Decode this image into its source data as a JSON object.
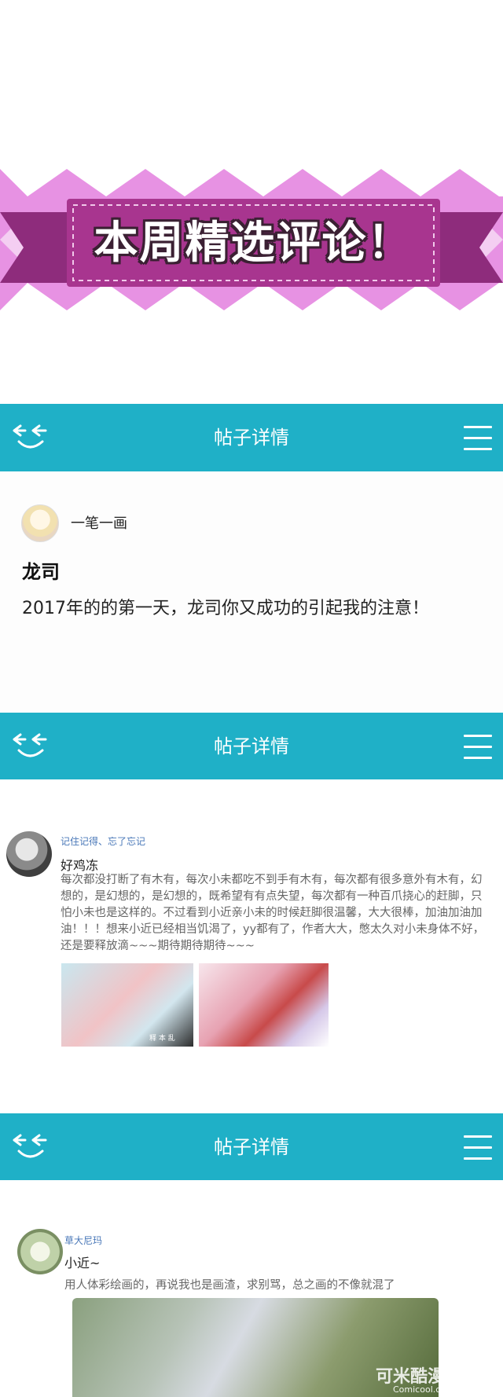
{
  "banner": {
    "title": "本周精选评论！"
  },
  "app_header": {
    "title": "帖子详情"
  },
  "post1": {
    "username": "一笔一画",
    "title": "龙司",
    "body": "2017年的的第一天，龙司你又成功的引起我的注意！"
  },
  "post2": {
    "tag": "记住记得、忘了忘记",
    "username": "好鸡冻",
    "body": "每次都没打断了有木有，每次小未都吃不到手有木有，每次都有很多意外有木有，幻想的，是幻想的，是幻想的，既希望有有点失望，每次都有一种百爪挠心的赶脚，只怕小未也是这样的。不过看到小近亲小未的时候赶脚很温馨，大大很棒，加油加油加油！！！想来小近已经相当饥渴了，yy都有了，作者大大，憋太久对小未身体不好，还是要释放滴~~~期待期待期待~~~",
    "image_caption": "释 本 乱"
  },
  "post3": {
    "tag": "草大尼玛",
    "username": "小近~",
    "body": "用人体彩绘画的，再说我也是画渣，求别骂，总之画的不像就混了",
    "watermark": "可米酷漫画",
    "watermark_url": "Comicool.cn"
  },
  "colors": {
    "appbar": "#1fb0c7",
    "ribbon": "#a8358f",
    "zigzag": "#e38de3"
  },
  "icons": [
    "app-logo-icon",
    "menu-icon"
  ]
}
